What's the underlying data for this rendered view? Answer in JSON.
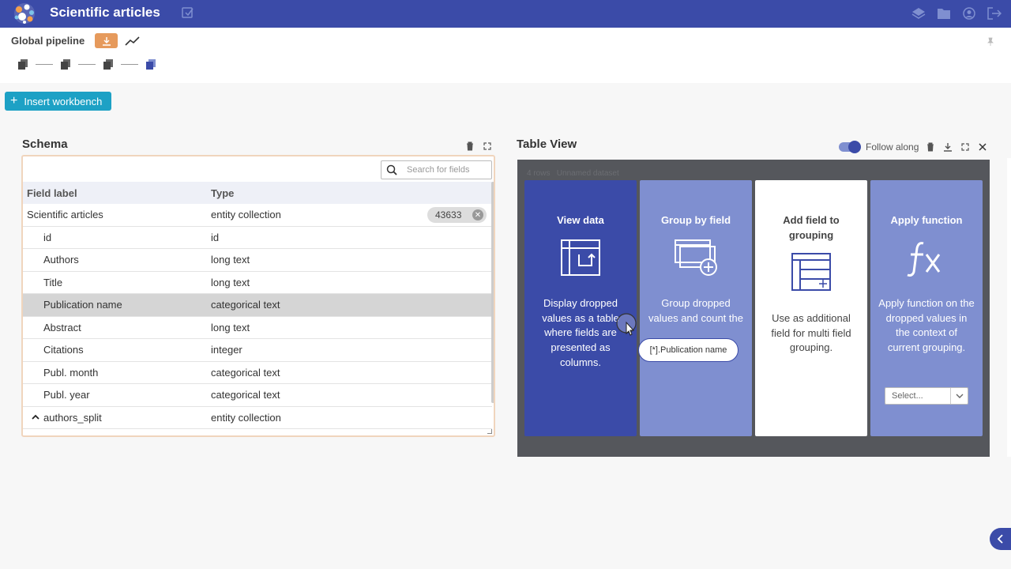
{
  "app": {
    "title": "Scientific articles"
  },
  "pipeline": {
    "label": "Global pipeline"
  },
  "insert_button": {
    "label": "Insert workbench"
  },
  "schema": {
    "title": "Schema",
    "search_placeholder": "Search for fields",
    "columns": [
      "Field label",
      "Type"
    ],
    "rows": [
      {
        "label": "Scientific articles",
        "type": "entity collection",
        "count": "43633"
      },
      {
        "label": "id",
        "type": "id"
      },
      {
        "label": "Authors",
        "type": "long text"
      },
      {
        "label": "Title",
        "type": "long text"
      },
      {
        "label": "Publication name",
        "type": "categorical text"
      },
      {
        "label": "Abstract",
        "type": "long text"
      },
      {
        "label": "Citations",
        "type": "integer"
      },
      {
        "label": "Publ. month",
        "type": "categorical text"
      },
      {
        "label": "Publ. year",
        "type": "categorical text"
      },
      {
        "label": "authors_split",
        "type": "entity collection"
      }
    ]
  },
  "table_view": {
    "title": "Table View",
    "follow_along": "Follow along",
    "meta_rows": "4 rows",
    "meta_dataset": "Unnamed dataset",
    "cards": [
      {
        "title": "View data",
        "desc": "Display dropped values as a table where fields are presented as columns."
      },
      {
        "title": "Group by field",
        "desc": "Group dropped values and count the"
      },
      {
        "title": "Add field to grouping",
        "desc": "Use as additional field for multi field grouping."
      },
      {
        "title": "Apply function",
        "desc": "Apply function on the dropped values in the context of current grouping."
      }
    ],
    "select_placeholder": "Select...",
    "drag_chip": "[*].Publication name"
  },
  "colors": {
    "primary": "#3b4ba8",
    "secondary": "#7f8fd0",
    "accent": "#1da1c5",
    "orange": "#e69a5c"
  }
}
